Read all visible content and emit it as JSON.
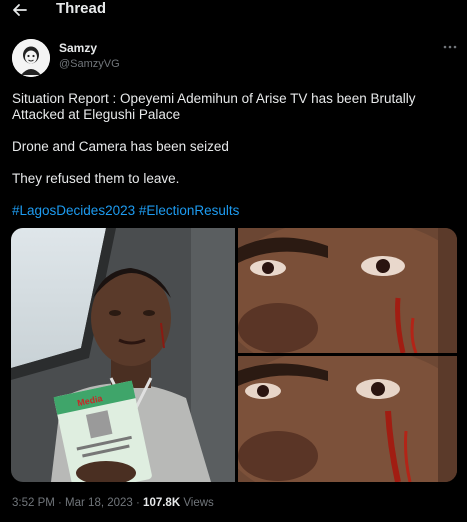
{
  "header": {
    "title": "Thread"
  },
  "tweet": {
    "author_name": "Samzy",
    "author_handle": "@SamzyVG",
    "paragraphs": [
      "Situation Report : Opeyemi Ademihun of Arise TV has been Brutally Attacked at Elegushi Palace",
      "Drone and Camera has been seized",
      "They refused them to leave."
    ],
    "hashtags": [
      "#LagosDecides2023",
      "#ElectionResults"
    ],
    "timestamp": "3:52 PM · Mar 18, 2023 · ",
    "views_count": "107.8K",
    "views_label": " Views",
    "media_card_text": "Media"
  },
  "colors": {
    "background": "#000000",
    "text": "#e7e9ea",
    "secondary": "#71767b",
    "link": "#1d9bf0"
  }
}
